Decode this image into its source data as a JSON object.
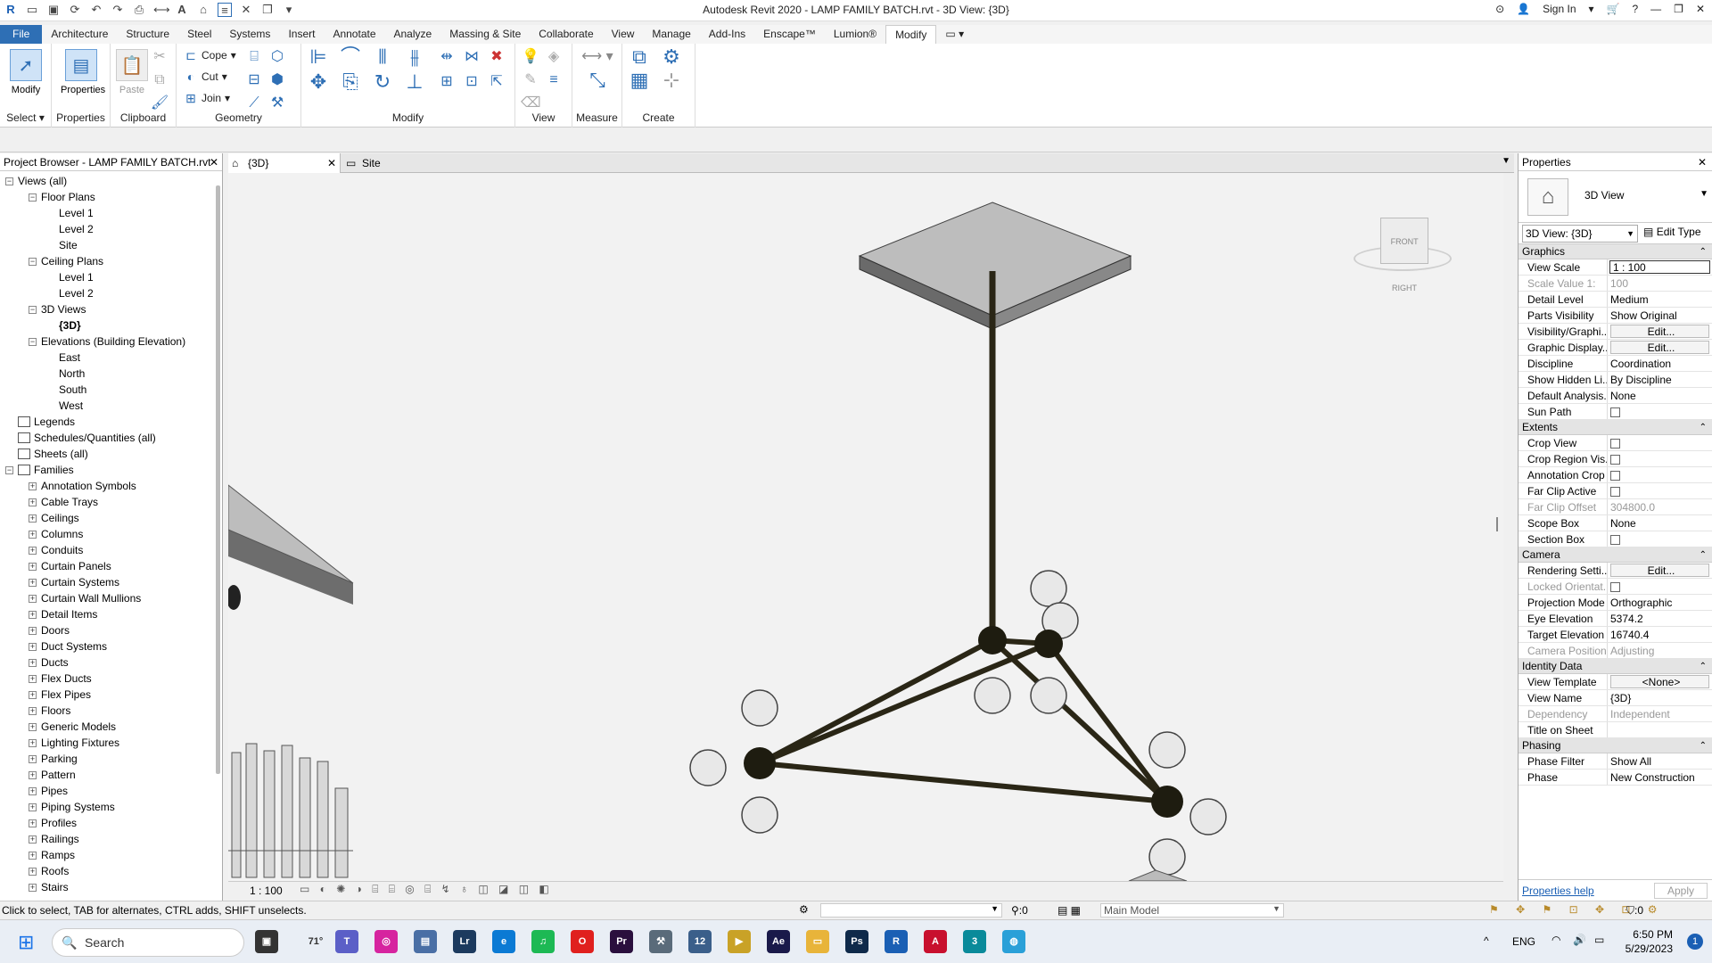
{
  "app": {
    "title": "Autodesk Revit 2020 - LAMP FAMILY BATCH.rvt - 3D View: {3D}",
    "sign_in": "Sign In"
  },
  "ribbon_tabs": [
    "File",
    "Architecture",
    "Structure",
    "Steel",
    "Systems",
    "Insert",
    "Annotate",
    "Analyze",
    "Massing & Site",
    "Collaborate",
    "View",
    "Manage",
    "Add-Ins",
    "Enscape™",
    "Lumion®",
    "Modify"
  ],
  "ribbon": {
    "modify_label": "Modify",
    "properties_label": "Properties",
    "paste_label": "Paste",
    "cope_label": "Cope",
    "cut_label": "Cut",
    "join_label": "Join",
    "groups": [
      "Select",
      "Properties",
      "Clipboard",
      "Geometry",
      "Modify",
      "View",
      "Measure",
      "Create"
    ]
  },
  "project_browser": {
    "title": "Project Browser - LAMP FAMILY BATCH.rvt",
    "items": [
      "Views (all)",
      "Floor Plans",
      "Level 1",
      "Level 2",
      "Site",
      "Ceiling Plans",
      "Level 1",
      "Level 2",
      "3D Views",
      "{3D}",
      "Elevations (Building Elevation)",
      "East",
      "North",
      "South",
      "West",
      "Legends",
      "Schedules/Quantities (all)",
      "Sheets (all)",
      "Families",
      "Annotation Symbols",
      "Cable Trays",
      "Ceilings",
      "Columns",
      "Conduits",
      "Curtain Panels",
      "Curtain Systems",
      "Curtain Wall Mullions",
      "Detail Items",
      "Doors",
      "Duct Systems",
      "Ducts",
      "Flex Ducts",
      "Flex Pipes",
      "Floors",
      "Generic Models",
      "Lighting Fixtures",
      "Parking",
      "Pattern",
      "Pipes",
      "Piping Systems",
      "Profiles",
      "Railings",
      "Ramps",
      "Roofs",
      "Stairs"
    ]
  },
  "view_tabs": [
    "{3D}",
    "Site"
  ],
  "viewcube": {
    "front": "FRONT",
    "right": "RIGHT"
  },
  "view_scale": "1 : 100",
  "properties": {
    "title": "Properties",
    "type_name": "3D View",
    "instance": "3D View: {3D}",
    "edit_type": "Edit Type",
    "categories": [
      {
        "name": "Graphics",
        "rows": [
          [
            "View Scale",
            "1 : 100"
          ],
          [
            "Scale Value    1:",
            "100"
          ],
          [
            "Detail Level",
            "Medium"
          ],
          [
            "Parts Visibility",
            "Show Original"
          ],
          [
            "Visibility/Graphi...",
            "Edit..."
          ],
          [
            "Graphic Display...",
            "Edit..."
          ],
          [
            "Discipline",
            "Coordination"
          ],
          [
            "Show Hidden Li...",
            "By Discipline"
          ],
          [
            "Default Analysis...",
            "None"
          ],
          [
            "Sun Path",
            ""
          ]
        ]
      },
      {
        "name": "Extents",
        "rows": [
          [
            "Crop View",
            ""
          ],
          [
            "Crop Region Vis...",
            ""
          ],
          [
            "Annotation Crop",
            ""
          ],
          [
            "Far Clip Active",
            ""
          ],
          [
            "Far Clip Offset",
            "304800.0"
          ],
          [
            "Scope Box",
            "None"
          ],
          [
            "Section Box",
            ""
          ]
        ]
      },
      {
        "name": "Camera",
        "rows": [
          [
            "Rendering Setti...",
            "Edit..."
          ],
          [
            "Locked Orientat...",
            ""
          ],
          [
            "Projection Mode",
            "Orthographic"
          ],
          [
            "Eye Elevation",
            "5374.2"
          ],
          [
            "Target Elevation",
            "16740.4"
          ],
          [
            "Camera Position",
            "Adjusting"
          ]
        ]
      },
      {
        "name": "Identity Data",
        "rows": [
          [
            "View Template",
            "<None>"
          ],
          [
            "View Name",
            "{3D}"
          ],
          [
            "Dependency",
            "Independent"
          ],
          [
            "Title on Sheet",
            ""
          ]
        ]
      },
      {
        "name": "Phasing",
        "rows": [
          [
            "Phase Filter",
            "Show All"
          ],
          [
            "Phase",
            "New Construction"
          ]
        ]
      }
    ],
    "help": "Properties help",
    "apply": "Apply"
  },
  "status": {
    "text": "Click to select, TAB for alternates, CTRL adds, SHIFT unselects.",
    "zero_a": ":0",
    "model": "Main Model",
    "zero_b": ":0"
  },
  "taskbar": {
    "search": "Search",
    "weather": "71°",
    "lang": "ENG",
    "time": "6:50 PM",
    "date": "5/29/2023",
    "notif": "1"
  }
}
